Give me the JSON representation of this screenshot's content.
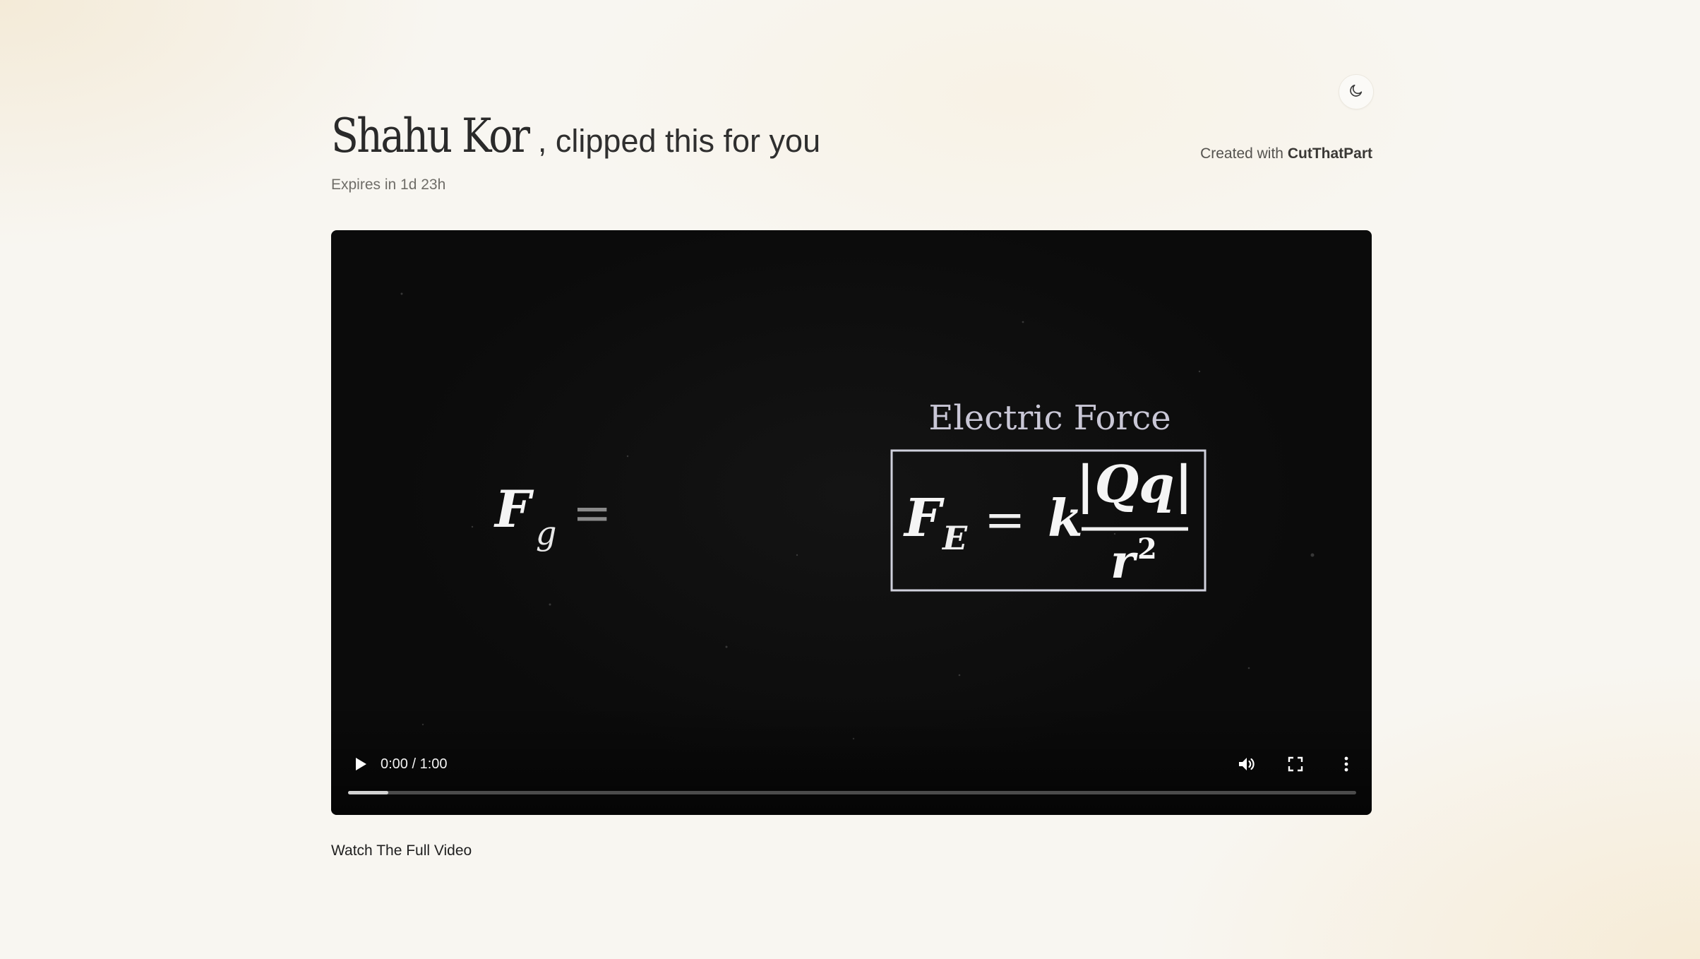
{
  "header": {
    "name": "Shahu Kor",
    "clipped_text": ", clipped this for you",
    "expires": "Expires in 1d 23h",
    "created_prefix": "Created with",
    "created_brand": "CutThatPart"
  },
  "theme_toggle": {
    "icon": "moon-icon"
  },
  "video": {
    "frame": {
      "left_equation": {
        "symbol": "F",
        "subscript": "g",
        "operator": "="
      },
      "title": "Electric Force",
      "formula": {
        "lhs": "F",
        "lhs_subscript": "E",
        "equals": "=",
        "constant": "k",
        "numerator": "|Qq|",
        "denominator": "r",
        "exponent": "2"
      }
    },
    "controls": {
      "play_icon": "play-icon",
      "time": "0:00 / 1:00",
      "volume_icon": "volume-icon",
      "fullscreen_icon": "fullscreen-icon",
      "more_icon": "more-vertical-icon",
      "progress": 0.04
    }
  },
  "footer": {
    "watch_full": "Watch The Full Video"
  }
}
